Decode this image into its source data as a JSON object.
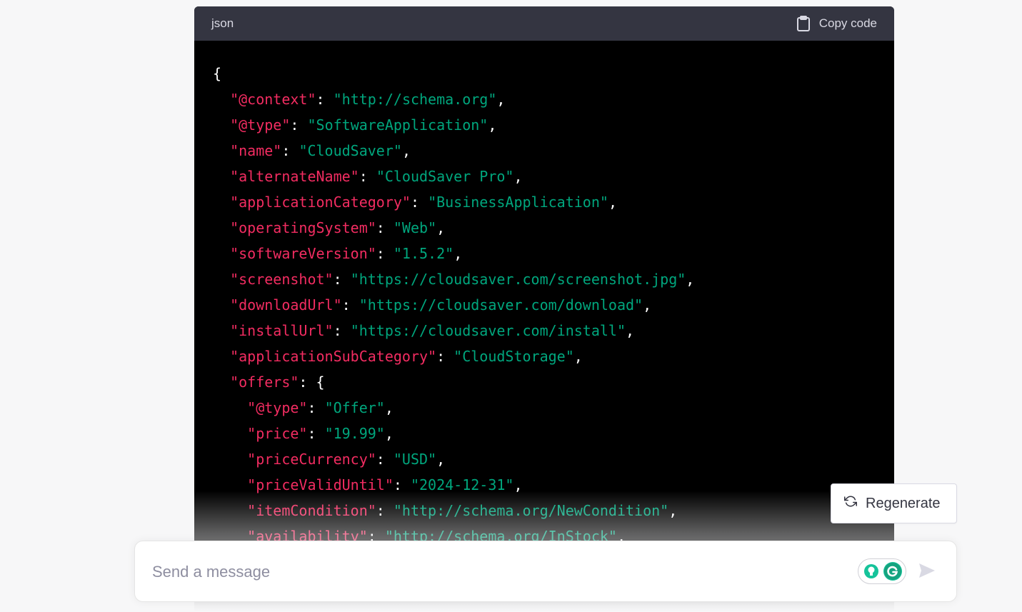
{
  "code_block": {
    "language": "json",
    "copy_label": "Copy code",
    "lines": [
      [
        {
          "t": "p",
          "v": "{"
        }
      ],
      [
        {
          "t": "p",
          "v": "  "
        },
        {
          "t": "k",
          "v": "\"@context\""
        },
        {
          "t": "p",
          "v": ": "
        },
        {
          "t": "s",
          "v": "\"http://schema.org\""
        },
        {
          "t": "p",
          "v": ","
        }
      ],
      [
        {
          "t": "p",
          "v": "  "
        },
        {
          "t": "k",
          "v": "\"@type\""
        },
        {
          "t": "p",
          "v": ": "
        },
        {
          "t": "s",
          "v": "\"SoftwareApplication\""
        },
        {
          "t": "p",
          "v": ","
        }
      ],
      [
        {
          "t": "p",
          "v": "  "
        },
        {
          "t": "k",
          "v": "\"name\""
        },
        {
          "t": "p",
          "v": ": "
        },
        {
          "t": "s",
          "v": "\"CloudSaver\""
        },
        {
          "t": "p",
          "v": ","
        }
      ],
      [
        {
          "t": "p",
          "v": "  "
        },
        {
          "t": "k",
          "v": "\"alternateName\""
        },
        {
          "t": "p",
          "v": ": "
        },
        {
          "t": "s",
          "v": "\"CloudSaver Pro\""
        },
        {
          "t": "p",
          "v": ","
        }
      ],
      [
        {
          "t": "p",
          "v": "  "
        },
        {
          "t": "k",
          "v": "\"applicationCategory\""
        },
        {
          "t": "p",
          "v": ": "
        },
        {
          "t": "s",
          "v": "\"BusinessApplication\""
        },
        {
          "t": "p",
          "v": ","
        }
      ],
      [
        {
          "t": "p",
          "v": "  "
        },
        {
          "t": "k",
          "v": "\"operatingSystem\""
        },
        {
          "t": "p",
          "v": ": "
        },
        {
          "t": "s",
          "v": "\"Web\""
        },
        {
          "t": "p",
          "v": ","
        }
      ],
      [
        {
          "t": "p",
          "v": "  "
        },
        {
          "t": "k",
          "v": "\"softwareVersion\""
        },
        {
          "t": "p",
          "v": ": "
        },
        {
          "t": "s",
          "v": "\"1.5.2\""
        },
        {
          "t": "p",
          "v": ","
        }
      ],
      [
        {
          "t": "p",
          "v": "  "
        },
        {
          "t": "k",
          "v": "\"screenshot\""
        },
        {
          "t": "p",
          "v": ": "
        },
        {
          "t": "s",
          "v": "\"https://cloudsaver.com/screenshot.jpg\""
        },
        {
          "t": "p",
          "v": ","
        }
      ],
      [
        {
          "t": "p",
          "v": "  "
        },
        {
          "t": "k",
          "v": "\"downloadUrl\""
        },
        {
          "t": "p",
          "v": ": "
        },
        {
          "t": "s",
          "v": "\"https://cloudsaver.com/download\""
        },
        {
          "t": "p",
          "v": ","
        }
      ],
      [
        {
          "t": "p",
          "v": "  "
        },
        {
          "t": "k",
          "v": "\"installUrl\""
        },
        {
          "t": "p",
          "v": ": "
        },
        {
          "t": "s",
          "v": "\"https://cloudsaver.com/install\""
        },
        {
          "t": "p",
          "v": ","
        }
      ],
      [
        {
          "t": "p",
          "v": "  "
        },
        {
          "t": "k",
          "v": "\"applicationSubCategory\""
        },
        {
          "t": "p",
          "v": ": "
        },
        {
          "t": "s",
          "v": "\"CloudStorage\""
        },
        {
          "t": "p",
          "v": ","
        }
      ],
      [
        {
          "t": "p",
          "v": "  "
        },
        {
          "t": "k",
          "v": "\"offers\""
        },
        {
          "t": "p",
          "v": ": {"
        }
      ],
      [
        {
          "t": "p",
          "v": "    "
        },
        {
          "t": "k",
          "v": "\"@type\""
        },
        {
          "t": "p",
          "v": ": "
        },
        {
          "t": "s",
          "v": "\"Offer\""
        },
        {
          "t": "p",
          "v": ","
        }
      ],
      [
        {
          "t": "p",
          "v": "    "
        },
        {
          "t": "k",
          "v": "\"price\""
        },
        {
          "t": "p",
          "v": ": "
        },
        {
          "t": "s",
          "v": "\"19.99\""
        },
        {
          "t": "p",
          "v": ","
        }
      ],
      [
        {
          "t": "p",
          "v": "    "
        },
        {
          "t": "k",
          "v": "\"priceCurrency\""
        },
        {
          "t": "p",
          "v": ": "
        },
        {
          "t": "s",
          "v": "\"USD\""
        },
        {
          "t": "p",
          "v": ","
        }
      ],
      [
        {
          "t": "p",
          "v": "    "
        },
        {
          "t": "k",
          "v": "\"priceValidUntil\""
        },
        {
          "t": "p",
          "v": ": "
        },
        {
          "t": "s",
          "v": "\"2024-12-31\""
        },
        {
          "t": "p",
          "v": ","
        }
      ],
      [
        {
          "t": "p",
          "v": "    "
        },
        {
          "t": "k",
          "v": "\"itemCondition\""
        },
        {
          "t": "p",
          "v": ": "
        },
        {
          "t": "s",
          "v": "\"http://schema.org/NewCondition\""
        },
        {
          "t": "p",
          "v": ","
        }
      ],
      [
        {
          "t": "p",
          "v": "    "
        },
        {
          "t": "k",
          "v": "\"availability\""
        },
        {
          "t": "p",
          "v": ": "
        },
        {
          "t": "s",
          "v": "\"http://schema.org/InStock\""
        },
        {
          "t": "p",
          "v": ","
        }
      ]
    ]
  },
  "regenerate": {
    "label": "Regenerate",
    "icon": "refresh-icon"
  },
  "composer": {
    "placeholder": "Send a message",
    "value": "",
    "extensions": [
      "lightbulb-icon",
      "grammarly-icon"
    ],
    "send_icon": "send-icon"
  },
  "colors": {
    "key": "#f22c61",
    "string": "#00a67d",
    "code_bg": "#000000",
    "header_bg": "#343541",
    "page_bg": "#f7f7f8"
  }
}
